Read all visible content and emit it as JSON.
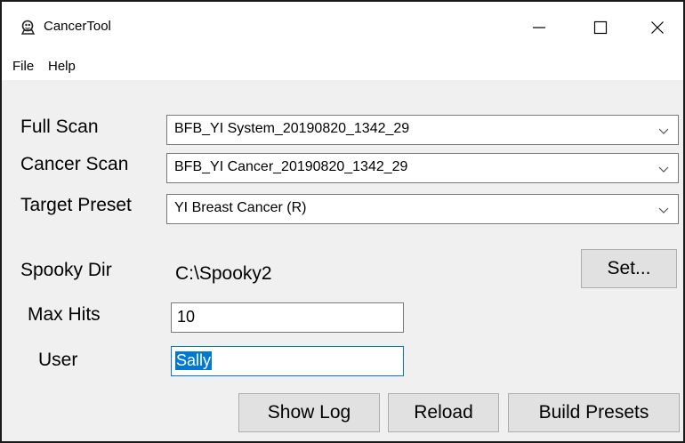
{
  "window": {
    "title": "CancerTool",
    "controls": {
      "minimize": "minimize",
      "maximize": "maximize",
      "close": "close"
    }
  },
  "menu": {
    "items": [
      {
        "label": "File"
      },
      {
        "label": "Help"
      }
    ]
  },
  "form": {
    "full_scan": {
      "label": "Full Scan",
      "value": "BFB_YI System_20190820_1342_29"
    },
    "cancer_scan": {
      "label": "Cancer Scan",
      "value": "BFB_YI Cancer_20190820_1342_29"
    },
    "target_preset": {
      "label": "Target Preset",
      "value": "YI Breast Cancer (R)"
    },
    "spooky_dir": {
      "label": "Spooky Dir",
      "value": "C:\\Spooky2",
      "set_button": "Set..."
    },
    "max_hits": {
      "label": "Max Hits",
      "value": "10"
    },
    "user": {
      "label": "User",
      "value": "Sally"
    }
  },
  "actions": {
    "show_log": "Show Log",
    "reload": "Reload",
    "build_presets": "Build Presets"
  },
  "colors": {
    "selection": "#0078d7",
    "window_bg": "#f0f0f0",
    "button_bg": "#e1e1e1"
  }
}
